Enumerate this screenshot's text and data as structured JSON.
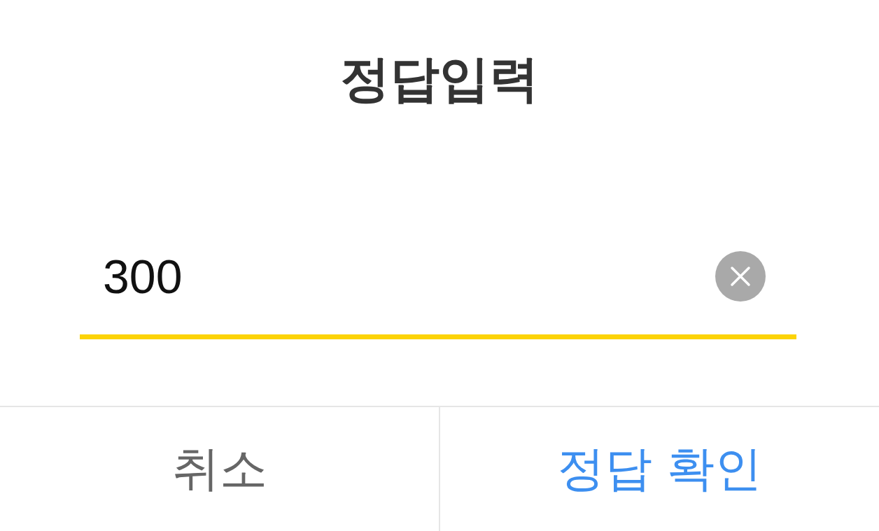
{
  "dialog": {
    "title": "정답입력",
    "answer": {
      "value": "300"
    },
    "buttons": [
      {
        "label": "취소",
        "kind": "cancel"
      },
      {
        "label": "정답 확인",
        "kind": "confirm"
      }
    ]
  }
}
